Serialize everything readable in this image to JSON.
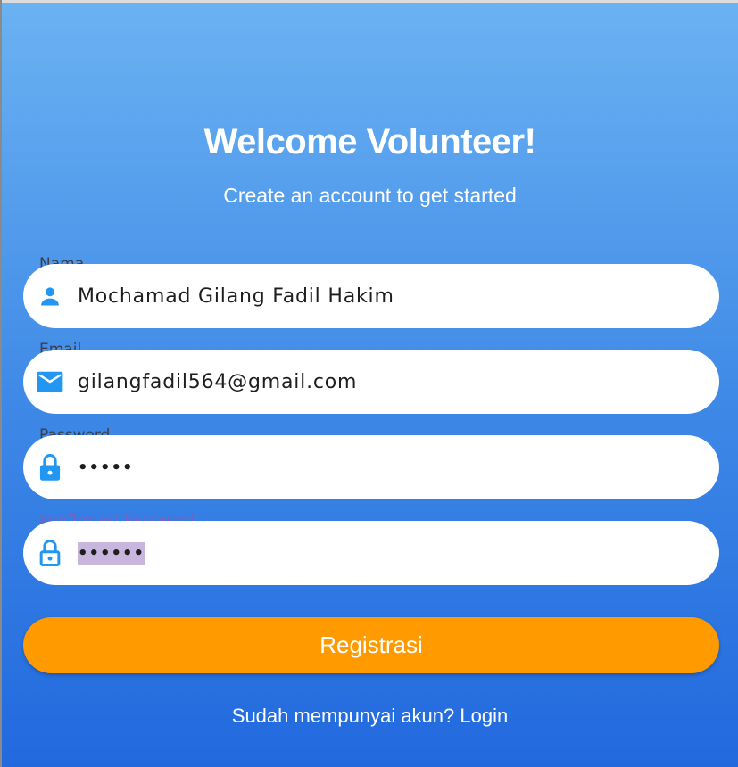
{
  "header": {
    "title": "Welcome Volunteer!",
    "subtitle": "Create an account to get started"
  },
  "form": {
    "fields": [
      {
        "label": "Nama",
        "icon": "person-icon",
        "value": "Mochamad Gilang Fadil Hakim"
      },
      {
        "label": "Email",
        "icon": "mail-icon",
        "value": "gilangfadil564@gmail.com"
      },
      {
        "label": "Password",
        "icon": "lock-icon",
        "value": "•••••"
      },
      {
        "label": "Konfirmasi Password",
        "icon": "lock-outline-icon",
        "value": "••••••"
      }
    ],
    "submit_label": "Registrasi",
    "login_link": "Sudah mempunyai akun? Login"
  },
  "colors": {
    "gradient_top": "#6bb2f2",
    "gradient_bottom": "#2169de",
    "icon": "#2196f3",
    "button": "#ff9a00",
    "focused_label": "#7a5fc4"
  }
}
